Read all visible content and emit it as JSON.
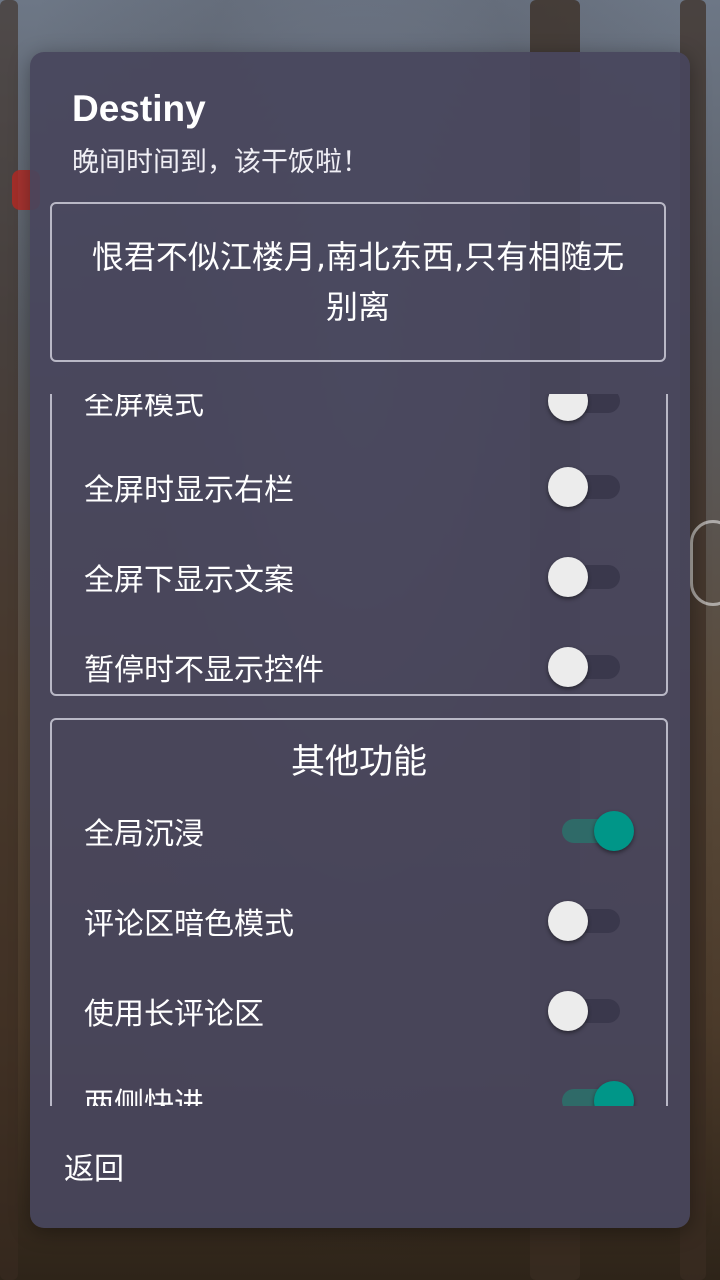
{
  "dialog": {
    "title": "Destiny",
    "subtitle": "晚间时间到，该干饭啦！",
    "quote": "恨君不似江楼月,南北东西,只有相随无别离",
    "back_label": "返回"
  },
  "display_section": {
    "partial_label": "全屏模式",
    "items": [
      {
        "label": "全屏模式",
        "on": false
      },
      {
        "label": "全屏时显示右栏",
        "on": false
      },
      {
        "label": "全屏下显示文案",
        "on": false
      },
      {
        "label": "暂停时不显示控件",
        "on": false
      }
    ]
  },
  "other_section": {
    "title": "其他功能",
    "items": [
      {
        "label": "全局沉浸",
        "on": true
      },
      {
        "label": "评论区暗色模式",
        "on": false
      },
      {
        "label": "使用长评论区",
        "on": false
      },
      {
        "label": "两侧快进",
        "on": true
      }
    ]
  },
  "colors": {
    "accent": "#009688",
    "dialog_bg": "#48465c",
    "border": "#b9b8c6"
  }
}
